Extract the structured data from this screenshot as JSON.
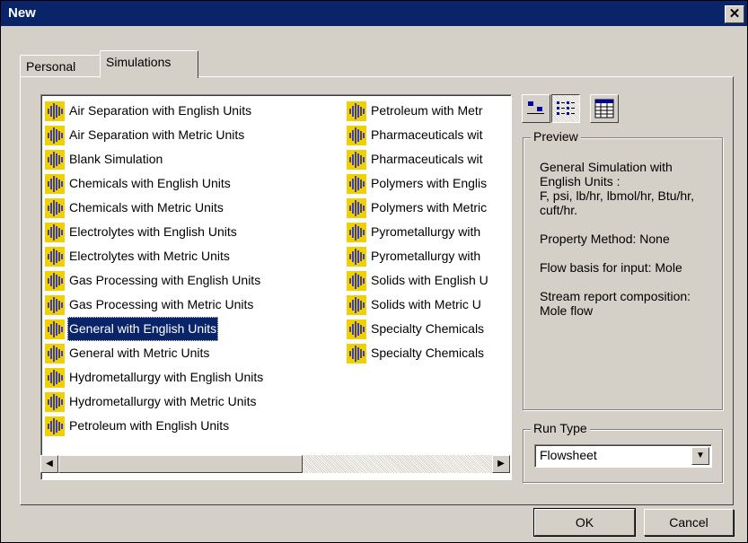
{
  "window": {
    "title": "New"
  },
  "tabs": [
    {
      "label": "Personal"
    },
    {
      "label": "Simulations"
    }
  ],
  "templates": {
    "column1": [
      {
        "label": "Air Separation with English Units"
      },
      {
        "label": "Air Separation with Metric Units"
      },
      {
        "label": "Blank Simulation"
      },
      {
        "label": "Chemicals with English Units"
      },
      {
        "label": "Chemicals with Metric Units"
      },
      {
        "label": "Electrolytes with English Units"
      },
      {
        "label": "Electrolytes with Metric Units"
      },
      {
        "label": "Gas Processing with English Units"
      },
      {
        "label": "Gas Processing with Metric Units"
      },
      {
        "label": "General with English Units",
        "selected": true
      },
      {
        "label": "General with Metric Units"
      },
      {
        "label": "Hydrometallurgy with English Units"
      },
      {
        "label": "Hydrometallurgy with Metric Units"
      },
      {
        "label": "Petroleum with English Units"
      }
    ],
    "column2": [
      {
        "label": "Petroleum with Metr"
      },
      {
        "label": "Pharmaceuticals wit"
      },
      {
        "label": "Pharmaceuticals wit"
      },
      {
        "label": "Polymers with Englis"
      },
      {
        "label": "Polymers with Metric"
      },
      {
        "label": "Pyrometallurgy with"
      },
      {
        "label": "Pyrometallurgy with"
      },
      {
        "label": "Solids with English U"
      },
      {
        "label": "Solids with Metric U"
      },
      {
        "label": "Specialty Chemicals"
      },
      {
        "label": "Specialty Chemicals"
      }
    ]
  },
  "view_buttons": [
    "large-icons-icon",
    "list-view-icon",
    "details-view-icon"
  ],
  "preview": {
    "label": "Preview",
    "lines": [
      "General Simulation with English Units :",
      "F, psi, lb/hr, lbmol/hr, Btu/hr, cuft/hr.",
      "Property Method: None",
      "Flow basis for input: Mole",
      "Stream report composition: Mole flow"
    ]
  },
  "run_type": {
    "label": "Run Type",
    "value": "Flowsheet"
  },
  "buttons": {
    "ok": "OK",
    "cancel": "Cancel"
  },
  "colors": {
    "titlebar": "#0a246a",
    "face": "#d4d0c8",
    "selection": "#0a246a"
  }
}
